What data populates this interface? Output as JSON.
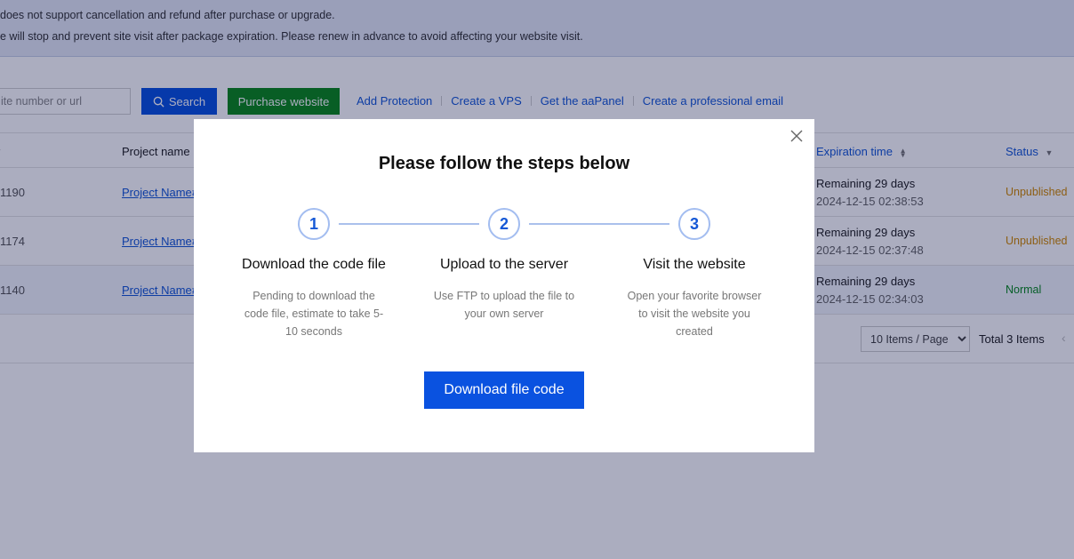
{
  "notice": {
    "line1": "does not support cancellation and refund after purchase or upgrade.",
    "line2": "e will stop and prevent site visit after package expiration. Please renew in advance to avoid affecting your website visit."
  },
  "toolbar": {
    "search_placeholder": "ite number or url",
    "search_label": "Search",
    "purchase_label": "Purchase website",
    "links": [
      "Add Protection",
      "Create a VPS",
      "Get the aaPanel",
      "Create a professional email"
    ]
  },
  "table": {
    "columns": {
      "id": "r",
      "name": "Project name",
      "expiration": "Expiration time",
      "status": "Status"
    },
    "rows": [
      {
        "id": "1190",
        "name": "Project Name#",
        "remaining": "Remaining 29 days",
        "date": "2024-12-15 02:38:53",
        "status": "Unpublished"
      },
      {
        "id": "1174",
        "name": "Project Name#",
        "remaining": "Remaining 29 days",
        "date": "2024-12-15 02:37:48",
        "status": "Unpublished"
      },
      {
        "id": "1140",
        "name": "Project Name#",
        "remaining": "Remaining 29 days",
        "date": "2024-12-15 02:34:03",
        "status": "Normal"
      }
    ]
  },
  "pagination": {
    "page_size": "10 Items / Page",
    "total": "Total 3 Items"
  },
  "modal": {
    "title": "Please follow the steps below",
    "steps": [
      {
        "number": "1",
        "title": "Download the code file",
        "description": "Pending to download the code file, estimate to take 5-10 seconds"
      },
      {
        "number": "2",
        "title": "Upload to the server",
        "description": "Use FTP to upload the file to your own server"
      },
      {
        "number": "3",
        "title": "Visit the website",
        "description": "Open your favorite browser to visit the website you created"
      }
    ],
    "download_label": "Download file code"
  },
  "colors": {
    "primary": "#0a52e0",
    "purchase": "#0d8a1a",
    "link": "#1558d6",
    "unpublished": "#d28a00",
    "normal": "#0a8a1e"
  },
  "icons": {
    "search": "search-icon",
    "close": "close-icon",
    "sort": "sort-icon",
    "filter": "caret-down-icon"
  }
}
